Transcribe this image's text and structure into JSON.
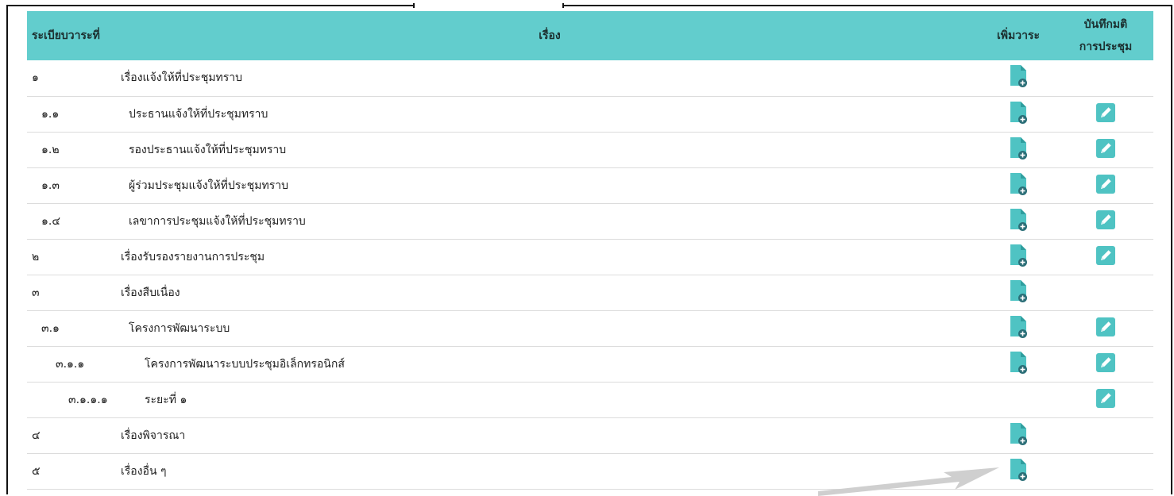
{
  "table": {
    "headers": {
      "no": "ระเบียบวาระที่",
      "topic": "เรื่อง",
      "add": "เพิ่มวาระ",
      "minutes_line1": "บันทึกมติ",
      "minutes_line2": "การประชุม"
    },
    "rows": [
      {
        "no": "๑",
        "title": "เรื่องแจ้งให้ที่ประชุมทราบ",
        "level": 0,
        "add_icon": "add-document-icon",
        "minutes_icon": null
      },
      {
        "no": "๑.๑",
        "title": "ประธานแจ้งให้ที่ประชุมทราบ",
        "level": 1,
        "add_icon": "add-document-icon",
        "minutes_icon": "edit-icon"
      },
      {
        "no": "๑.๒",
        "title": "รองประธานแจ้งให้ที่ประชุมทราบ",
        "level": 1,
        "add_icon": "add-document-icon",
        "minutes_icon": "edit-icon"
      },
      {
        "no": "๑.๓",
        "title": "ผู้ร่วมประชุมแจ้งให้ที่ประชุมทราบ",
        "level": 1,
        "add_icon": "add-document-icon",
        "minutes_icon": "edit-icon"
      },
      {
        "no": "๑.๔",
        "title": "เลขาการประชุมแจ้งให้ที่ประชุมทราบ",
        "level": 1,
        "add_icon": "add-document-icon",
        "minutes_icon": "edit-icon"
      },
      {
        "no": "๒",
        "title": "เรื่องรับรองรายงานการประชุม",
        "level": 0,
        "add_icon": "add-document-icon",
        "minutes_icon": "edit-icon"
      },
      {
        "no": "๓",
        "title": "เรื่องสืบเนื่อง",
        "level": 0,
        "add_icon": "add-document-icon",
        "minutes_icon": null
      },
      {
        "no": "๓.๑",
        "title": "โครงการพัฒนาระบบ",
        "level": 1,
        "add_icon": "add-document-icon",
        "minutes_icon": "edit-icon"
      },
      {
        "no": "๓.๑.๑",
        "title": "โครงการพัฒนาระบบประชุมอิเล็กทรอนิกส์",
        "level": 2,
        "add_icon": "add-document-icon",
        "minutes_icon": "edit-icon"
      },
      {
        "no": "๓.๑.๑.๑",
        "title": "ระยะที่ ๑",
        "level": 3,
        "add_icon": null,
        "minutes_icon": "edit-icon"
      },
      {
        "no": "๔",
        "title": "เรื่องพิจารณา",
        "level": 0,
        "add_icon": "add-document-icon",
        "minutes_icon": null
      },
      {
        "no": "๕",
        "title": "เรื่องอื่น ๆ",
        "level": 0,
        "add_icon": "add-document-icon",
        "minutes_icon": null
      }
    ]
  },
  "colors": {
    "header_bg": "#62cdcd",
    "icon_teal": "#4fc3c3",
    "icon_teal_dark": "#2e9e9e",
    "arrow": "#cfcfcf"
  }
}
